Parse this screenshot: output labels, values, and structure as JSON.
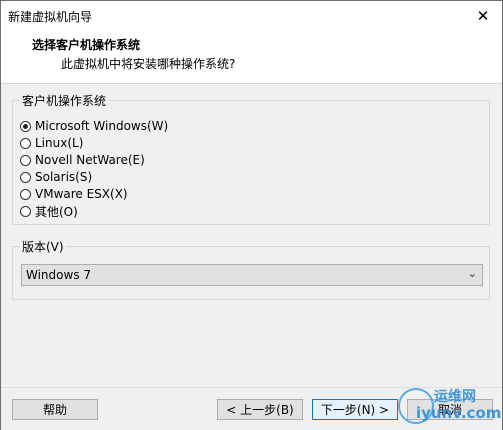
{
  "window": {
    "title": "新建虚拟机向导",
    "close_glyph": "✕"
  },
  "header": {
    "title": "选择客户机操作系统",
    "subtitle": "此虚拟机中将安装哪种操作系统?"
  },
  "os_group": {
    "label": "客户机操作系统",
    "options": [
      {
        "label": "Microsoft Windows(W)",
        "checked": true
      },
      {
        "label": "Linux(L)",
        "checked": false
      },
      {
        "label": "Novell NetWare(E)",
        "checked": false
      },
      {
        "label": "Solaris(S)",
        "checked": false
      },
      {
        "label": "VMware ESX(X)",
        "checked": false
      },
      {
        "label": "其他(O)",
        "checked": false
      }
    ]
  },
  "version_group": {
    "label": "版本(V)",
    "selected": "Windows 7",
    "arrow_glyph": "⌄"
  },
  "footer": {
    "help_label": "帮助",
    "back_label": "< 上一步(B)",
    "next_label": "下一步(N) >",
    "cancel_label": "取消"
  },
  "watermark": {
    "top_text": "运维网",
    "bottom_text": "iyunv.com"
  },
  "colors": {
    "accent": "#0078d7",
    "watermark": "#2d8fd8"
  }
}
